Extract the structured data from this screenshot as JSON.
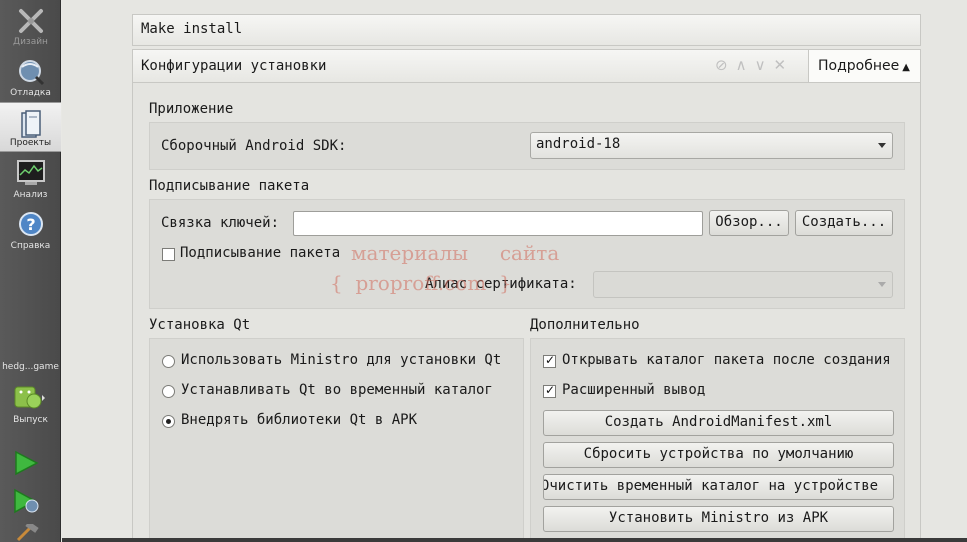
{
  "modebar": {
    "modes": [
      {
        "label": "Дизайн",
        "icon": "design-icon"
      },
      {
        "label": "Отладка",
        "icon": "debug-icon"
      },
      {
        "label": "Проекты",
        "icon": "projects-icon"
      },
      {
        "label": "Анализ",
        "icon": "analyze-icon"
      },
      {
        "label": "Справка",
        "icon": "help-icon"
      }
    ],
    "target": {
      "project": "hedg...game",
      "label": "Выпуск"
    }
  },
  "steps": {
    "make_install": "Make install",
    "config_title": "Конфигурации установки",
    "details_label": "Подробнее"
  },
  "application": {
    "title": "Приложение",
    "sdk_label": "Сборочный Android SDK:",
    "sdk_value": "android-18"
  },
  "signing": {
    "title": "Подписывание пакета",
    "keystore_label": "Связка ключей:",
    "keystore_value": "",
    "browse_label": "Обзор...",
    "create_label": "Создать...",
    "sign_checkbox_label": "Подписывание пакета",
    "sign_checked": false,
    "alias_label": "Алиас сертификата:",
    "alias_value": ""
  },
  "qt_install": {
    "title": "Установка Qt",
    "options": [
      {
        "label": "Использовать Ministro для установки Qt",
        "selected": false
      },
      {
        "label": "Устанавливать Qt во временный каталог",
        "selected": false
      },
      {
        "label": "Внедрять библиотеки Qt в APK",
        "selected": true
      }
    ]
  },
  "advanced": {
    "title": "Дополнительно",
    "open_dir_label": "Открывать каталог пакета после создания",
    "open_dir_checked": true,
    "verbose_label": "Расширенный вывод",
    "verbose_checked": true,
    "buttons": [
      "Создать AndroidManifest.xml",
      "Сбросить устройства по умолчанию",
      "Очистить временный каталог на устройстве",
      "Установить Ministro из APK"
    ]
  },
  "watermark": {
    "line1": "материалы     сайта",
    "line2": "{  proproff.com  }"
  }
}
